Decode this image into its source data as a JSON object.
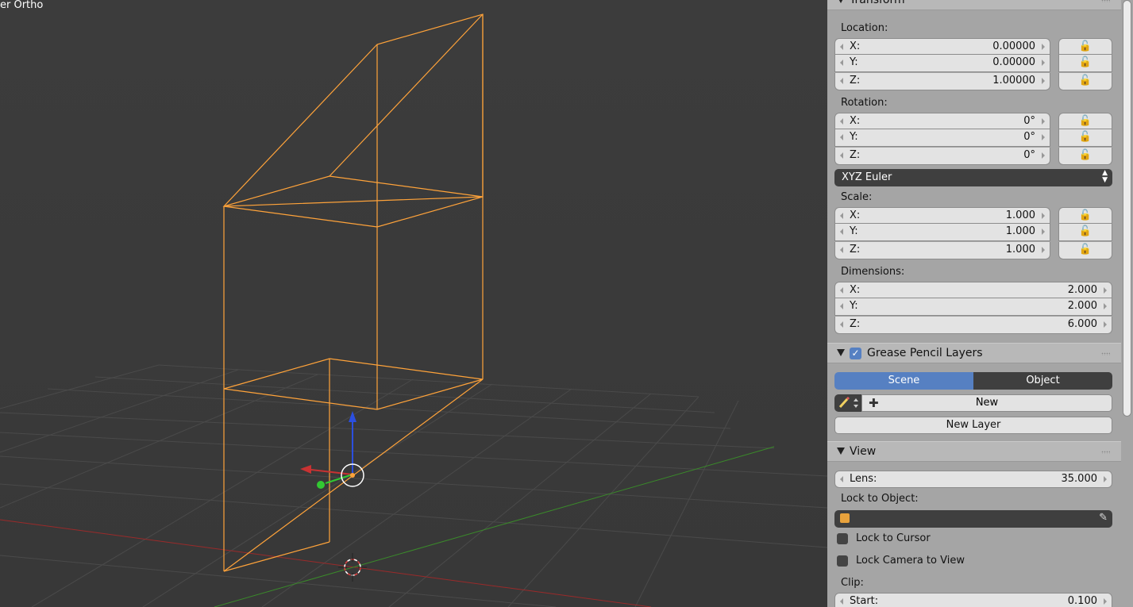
{
  "viewport": {
    "label": "er Ortho"
  },
  "transform": {
    "title": "Transform",
    "location_label": "Location:",
    "location": [
      {
        "axis": "X:",
        "value": "0.00000"
      },
      {
        "axis": "Y:",
        "value": "0.00000"
      },
      {
        "axis": "Z:",
        "value": "1.00000"
      }
    ],
    "rotation_label": "Rotation:",
    "rotation": [
      {
        "axis": "X:",
        "value": "0°"
      },
      {
        "axis": "Y:",
        "value": "0°"
      },
      {
        "axis": "Z:",
        "value": "0°"
      }
    ],
    "rotation_mode": "XYZ Euler",
    "scale_label": "Scale:",
    "scale": [
      {
        "axis": "X:",
        "value": "1.000"
      },
      {
        "axis": "Y:",
        "value": "1.000"
      },
      {
        "axis": "Z:",
        "value": "1.000"
      }
    ],
    "dimensions_label": "Dimensions:",
    "dimensions": [
      {
        "axis": "X:",
        "value": "2.000"
      },
      {
        "axis": "Y:",
        "value": "2.000"
      },
      {
        "axis": "Z:",
        "value": "6.000"
      }
    ]
  },
  "grease_pencil": {
    "title": "Grease Pencil Layers",
    "enabled": true,
    "tab_scene": "Scene",
    "tab_object": "Object",
    "new_label": "New",
    "new_layer_label": "New Layer"
  },
  "view": {
    "title": "View",
    "lens_label": "Lens:",
    "lens_value": "35.000",
    "lock_to_object_label": "Lock to Object:",
    "lock_to_cursor_label": "Lock to Cursor",
    "lock_camera_label": "Lock Camera to View",
    "clip_label": "Clip:",
    "clip_start_label": "Start:",
    "clip_start_value": "0.100"
  },
  "icons": {
    "lock": "lock-icon",
    "pencil": "pencil-icon",
    "plus": "plus-icon",
    "cube": "cube-icon",
    "eyedropper": "eyedropper-icon"
  },
  "colors": {
    "wire_selected": "#ffa33a",
    "accent_blue": "#5680c2",
    "x_axis": "#c83232",
    "y_axis": "#32c832",
    "z_axis": "#2b4fe0"
  }
}
